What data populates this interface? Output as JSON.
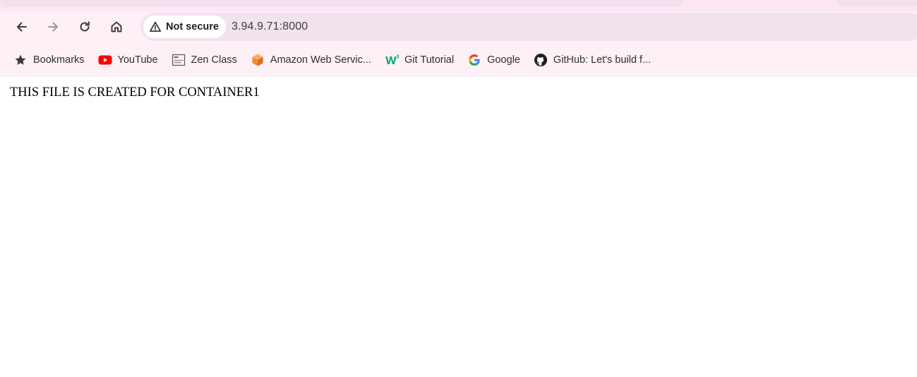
{
  "toolbar": {
    "back_icon": "arrow-left-icon",
    "forward_icon": "arrow-right-icon",
    "reload_icon": "reload-icon",
    "home_icon": "home-icon"
  },
  "omnibox": {
    "security_label": "Not secure",
    "url": "3.94.9.71:8000"
  },
  "bookmarks": [
    {
      "label": "Bookmarks",
      "icon": "star-icon"
    },
    {
      "label": "YouTube",
      "icon": "youtube-icon"
    },
    {
      "label": "Zen Class",
      "icon": "zen-class-icon"
    },
    {
      "label": "Amazon Web Servic...",
      "icon": "aws-cube-icon"
    },
    {
      "label": "Git Tutorial",
      "icon": "w3schools-icon"
    },
    {
      "label": "Google",
      "icon": "google-icon"
    },
    {
      "label": "GitHub: Let's build f...",
      "icon": "github-icon"
    }
  ],
  "page": {
    "text": "THIS FILE IS CREATED FOR CONTAINER1"
  },
  "colors": {
    "chrome_bg": "#fdf0f7",
    "omnibox_bg": "#f1e3ee",
    "youtube_red": "#ff0000",
    "aws_orange": "#f28d2a",
    "w3_green": "#04aa6d"
  }
}
